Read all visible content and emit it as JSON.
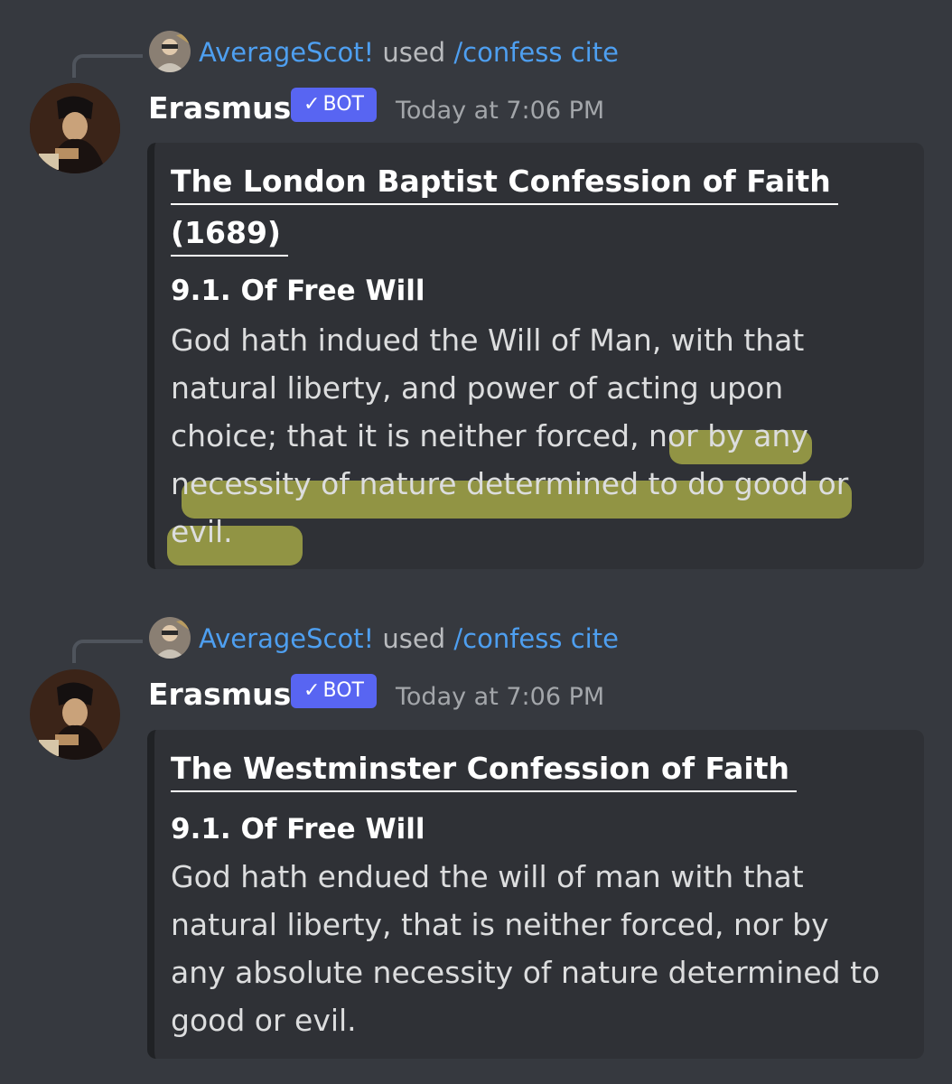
{
  "messages": [
    {
      "reply": {
        "user": "AverageScot!",
        "verb": "used",
        "command": "/confess cite"
      },
      "author": "Erasmus",
      "badge": "BOT",
      "badge_check": "✓",
      "timestamp": "Today at 7:06 PM",
      "embed": {
        "title_lines": [
          "The London Baptist Confession of Faith",
          "(1689)"
        ],
        "field_name": "9.1. Of Free Will",
        "field_lines": [
          "God hath indued the Will of Man, with that",
          "natural liberty, and power of acting upon",
          "choice; that it is neither forced, nor by any",
          "necessity of nature determined to do good or",
          "evil."
        ]
      }
    },
    {
      "reply": {
        "user": "AverageScot!",
        "verb": "used",
        "command": "/confess cite"
      },
      "author": "Erasmus",
      "badge": "BOT",
      "badge_check": "✓",
      "timestamp": "Today at 7:06 PM",
      "embed": {
        "title_lines": [
          "The Westminster Confession of Faith"
        ],
        "field_name": "9.1. Of Free Will",
        "field_lines": [
          "God hath endued the will of man with that",
          "natural liberty, that is neither forced, nor by",
          "any absolute necessity of nature determined to",
          "good or evil."
        ]
      }
    }
  ],
  "colors": {
    "background": "#36393f",
    "embed_background": "#2f3136",
    "link_blue": "#4e9ff0",
    "bot_badge": "#5865f2",
    "highlight": "#e1e550"
  }
}
